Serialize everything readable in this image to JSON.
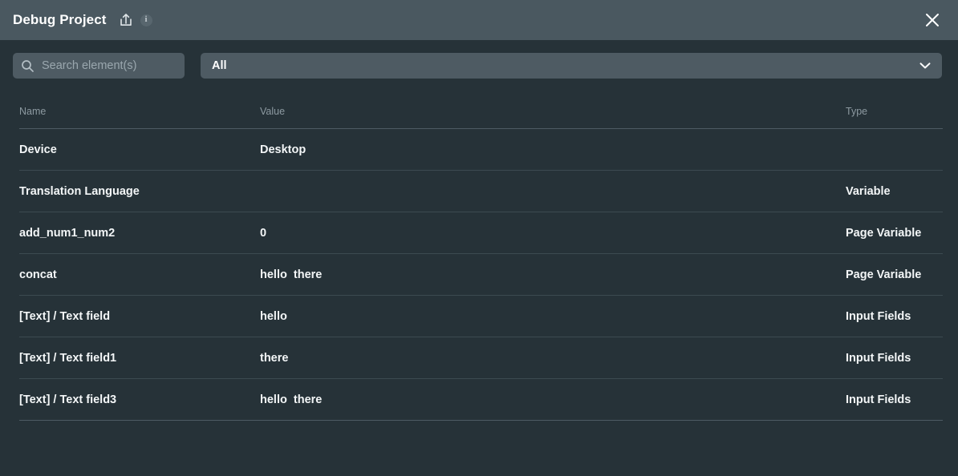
{
  "window": {
    "title": "Debug Project",
    "share_icon": "share-upload-icon",
    "info_icon": "info-icon",
    "info_glyph": "i",
    "close_icon": "close-icon",
    "header_bg": "#4a5860",
    "body_bg": "#263238",
    "field_bg": "#4e5b63"
  },
  "toolbar": {
    "search": {
      "icon": "search-icon",
      "value": "",
      "placeholder": "Search element(s)"
    },
    "filter": {
      "selected": "All",
      "chevron_icon": "chevron-down-icon"
    }
  },
  "table": {
    "columns": [
      "Name",
      "Value",
      "Type"
    ],
    "rows": [
      {
        "name": "Device",
        "value": "Desktop",
        "type": ""
      },
      {
        "name": "Translation Language",
        "value": "",
        "type": "Variable"
      },
      {
        "name": "add_num1_num2",
        "value": "0",
        "type": "Page Variable"
      },
      {
        "name": "concat",
        "value": "hello  there",
        "type": "Page Variable"
      },
      {
        "name": "[Text] / Text field",
        "value": "hello",
        "type": "Input Fields"
      },
      {
        "name": "[Text] / Text field1",
        "value": "there",
        "type": "Input Fields"
      },
      {
        "name": "[Text] / Text field3",
        "value": "hello  there",
        "type": "Input Fields"
      }
    ]
  }
}
